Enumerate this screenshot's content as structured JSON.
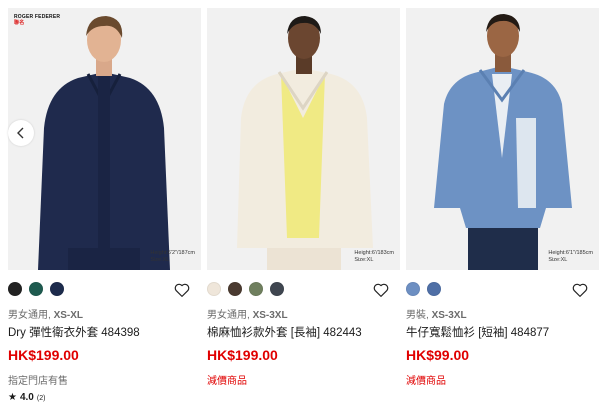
{
  "carousel": {
    "prev_icon": "chevron-left-icon"
  },
  "products": [
    {
      "brand_line1": "ROGER FEDERER",
      "brand_line2": "聯名",
      "height_note_line1": "Height:6'2\"/187cm",
      "height_note_line2": "Size:XL",
      "swatches": [
        "#222222",
        "#1e5a4f",
        "#1d2b4c"
      ],
      "gender_size": "男女通用,",
      "size_range": "XS-XL",
      "title": "Dry 彈性衛衣外套 484398",
      "price": "HK$199.00",
      "note": "指定門店有售",
      "note_red": false,
      "rating_score": "4.0",
      "rating_count": "(2)"
    },
    {
      "height_note_line1": "Height:6'/183cm",
      "height_note_line2": "Size:XL",
      "swatches": [
        "#efe6da",
        "#4a3a30",
        "#6f7f5e",
        "#3f4650"
      ],
      "gender_size": "男女通用,",
      "size_range": "XS-3XL",
      "title": "棉麻恤衫款外套 [長袖] 482443",
      "price": "HK$199.00",
      "note": "減價商品",
      "note_red": true
    },
    {
      "height_note_line1": "Height:6'1\"/185cm",
      "height_note_line2": "Size:XL",
      "swatches": [
        "#6d8fc2",
        "#4f6fa6"
      ],
      "gender_size": "男裝,",
      "size_range": "XS-3XL",
      "title": "牛仔寬鬆恤衫 [短袖] 484877",
      "price": "HK$99.00",
      "note": "減價商品",
      "note_red": true
    }
  ]
}
